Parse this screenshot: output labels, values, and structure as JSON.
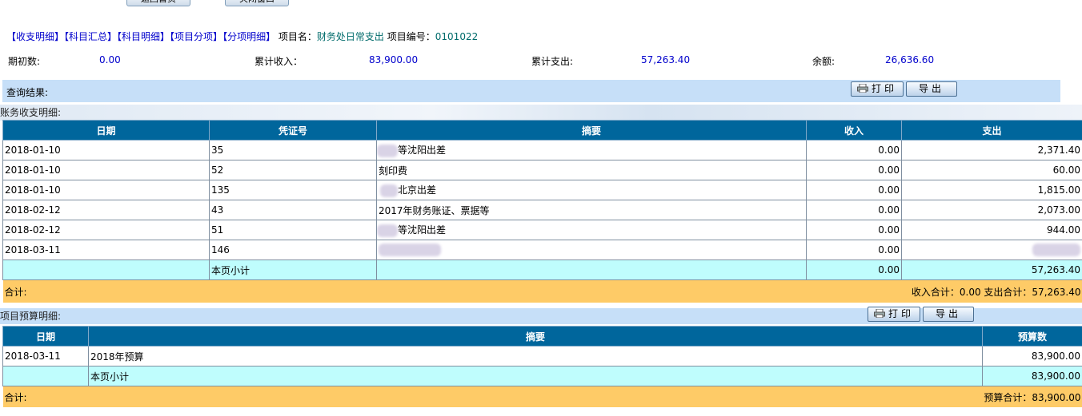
{
  "top_buttons": [
    "返回首页",
    "关闭窗口"
  ],
  "nav": {
    "links": [
      "【收支明细】",
      "【科目汇总】",
      "【科目明细】",
      "【项目分项】",
      "【分项明细】"
    ],
    "project_name_label": "项目名：",
    "project_name": "财务处日常支出",
    "project_code_label": "项目编号：",
    "project_code": "0101022"
  },
  "summary": {
    "opening_label": "期初数:",
    "opening_value": "0.00",
    "income_label": "累计收入：",
    "income_value": "83,900.00",
    "expense_label": "累计支出:",
    "expense_value": "57,263.40",
    "balance_label": "余额:",
    "balance_value": "26,636.60"
  },
  "query": {
    "label": "查询结果:"
  },
  "buttons": {
    "print": "打印",
    "export": "导出"
  },
  "ledger": {
    "title": "账务收支明细:",
    "headers": [
      "日期",
      "凭证号",
      "摘要",
      "收入",
      "支出"
    ],
    "rows": [
      {
        "date": "2018-01-10",
        "voucher": "35",
        "summary": "等沈阳出差",
        "income": "0.00",
        "expense": "2,371.40"
      },
      {
        "date": "2018-01-10",
        "voucher": "52",
        "summary": "刻印费",
        "income": "0.00",
        "expense": "60.00"
      },
      {
        "date": "2018-01-10",
        "voucher": "135",
        "summary": "北京出差",
        "income": "0.00",
        "expense": "1,815.00"
      },
      {
        "date": "2018-02-12",
        "voucher": "43",
        "summary": "2017年财务账证、票据等",
        "income": "0.00",
        "expense": "2,073.00"
      },
      {
        "date": "2018-02-12",
        "voucher": "51",
        "summary": "等沈阳出差",
        "income": "0.00",
        "expense": "944.00"
      },
      {
        "date": "2018-03-11",
        "voucher": "146",
        "summary": "",
        "income": "0.00",
        "expense": ""
      }
    ],
    "subtotal_label": "本页小计",
    "subtotal_income": "0.00",
    "subtotal_expense": "57,263.40",
    "total_label": "合计:",
    "total_text": "收入合计：0.00 支出合计：57,263.40"
  },
  "budget": {
    "title": "项目预算明细:",
    "headers": [
      "日期",
      "摘要",
      "预算数"
    ],
    "rows": [
      {
        "date": "2018-03-11",
        "summary": "2018年预算",
        "amount": "83,900.00"
      }
    ],
    "subtotal_label": "本页小计",
    "subtotal_amount": "83,900.00",
    "total_label": "合计:",
    "total_text": "预算合计：83,900.00"
  },
  "colors": {
    "header_bg": "#00669c",
    "subtotal_bg": "#bffdfd",
    "total_bg": "#fecb67",
    "query_bg": "#c6dff8",
    "link": "#0000cc"
  }
}
